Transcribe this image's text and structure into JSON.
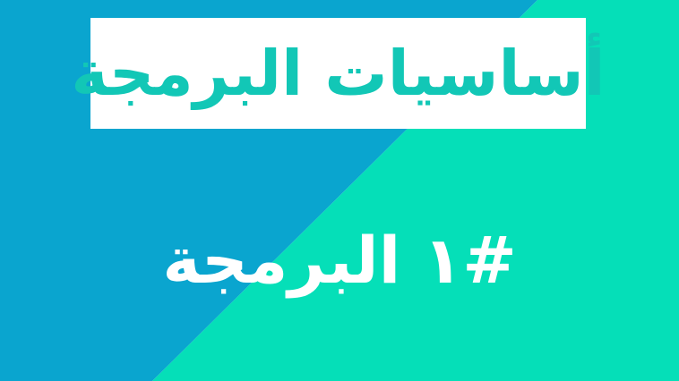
{
  "title": "أساسيات البرمجة",
  "subtitle": "#١ البرمجة",
  "colors": {
    "blue": "#0aa5cf",
    "teal": "#05dfb8",
    "title_text": "#12c7b6",
    "subtitle_text": "#ffffff",
    "title_box": "#ffffff"
  }
}
